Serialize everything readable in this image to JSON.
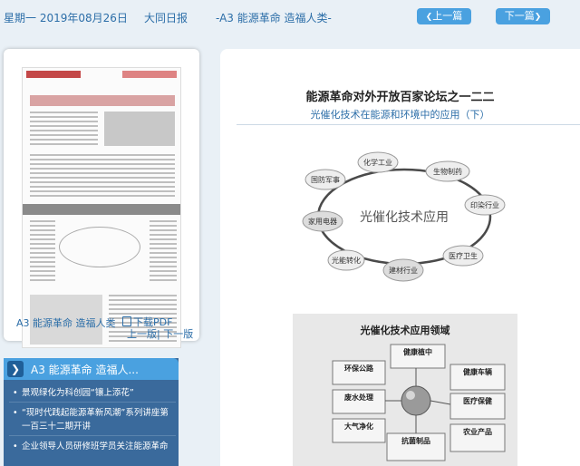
{
  "header": {
    "date": "星期一 2019年08月26日",
    "paper": "大同日报",
    "page": "-A3 能源革命 造福人类-",
    "prev_label": "上一篇",
    "next_label": "下一篇"
  },
  "thumbnail": {
    "caption": "A3 能源革命 造福人类",
    "pdf_label": "下载PDF",
    "page_nav": "上一版| 下一版"
  },
  "article_list": {
    "title": "A3 能源革命 造福人...",
    "items": [
      "景观绿化为科创园“镶上添花”",
      "“现时代践起能源革新风潮”系列讲座第一百三十二期开讲",
      "企业领导人员研修班学员关注能源革命"
    ]
  },
  "article": {
    "title": "能源革命对外开放百家论坛之一二二",
    "subtitle": "光催化技术在能源和环境中的应用（下）"
  },
  "diagram1": {
    "center": "光催化技术应用",
    "nodes": [
      "化学工业",
      "生物制药",
      "印染行业",
      "医疗卫生",
      "建材行业",
      "光能转化",
      "家用电器",
      "国防军事"
    ]
  },
  "diagram2": {
    "title": "光催化技术应用领域",
    "boxes": [
      "健康植中",
      "环保公路",
      "健康车辆",
      "废水处理",
      "医疗保健",
      "大气净化",
      "抗菌制品",
      "农业产品"
    ]
  },
  "colors": {
    "accent": "#4aa1e0",
    "link": "#2c6ea8",
    "panel": "#3a6a9c"
  }
}
